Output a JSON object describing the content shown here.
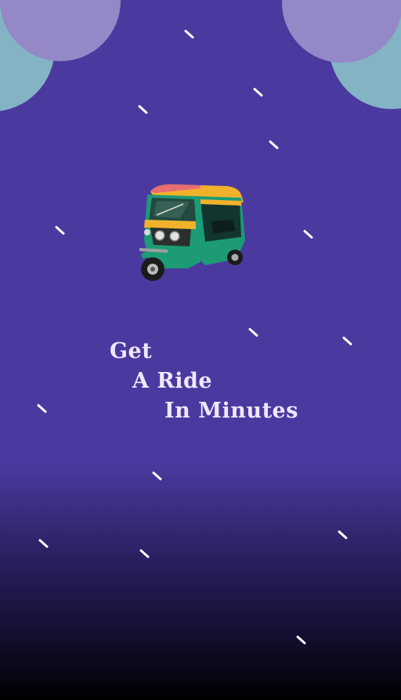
{
  "headline": {
    "line1": "Get",
    "line2": "A Ride",
    "line3": "In Minutes"
  },
  "illustration": {
    "icon": "auto-rickshaw-icon"
  },
  "colors": {
    "background_top": "#4a3a9f",
    "background_bottom": "#000000",
    "blob_teal": "#84b4c4",
    "blob_lavender": "#9488c6",
    "text": "#efe7ff",
    "rickshaw_green": "#1c9b75",
    "rickshaw_yellow": "#f2b12b"
  }
}
